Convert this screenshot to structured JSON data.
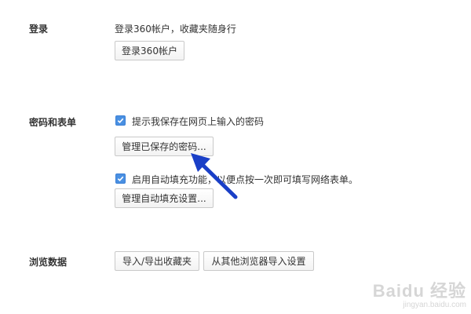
{
  "login": {
    "section_label": "登录",
    "description": "登录360帐户，收藏夹随身行",
    "button_label": "登录360帐户"
  },
  "password": {
    "section_label": "密码和表单",
    "save_prompt_label": "提示我保存在网页上输入的密码",
    "save_prompt_checked": true,
    "manage_saved_button": "管理已保存的密码...",
    "autofill_label": "启用自动填充功能，以便点按一次即可填写网络表单。",
    "autofill_checked": true,
    "manage_autofill_button": "管理自动填充设置..."
  },
  "browsing_data": {
    "section_label": "浏览数据",
    "import_export_button": "导入/导出收藏夹",
    "import_from_other_button": "从其他浏览器导入设置"
  },
  "annotation": {
    "arrow_color": "#1a3fc7"
  },
  "watermark": {
    "brand": "Baidu 经验",
    "url": "jingyan.baidu.com"
  }
}
